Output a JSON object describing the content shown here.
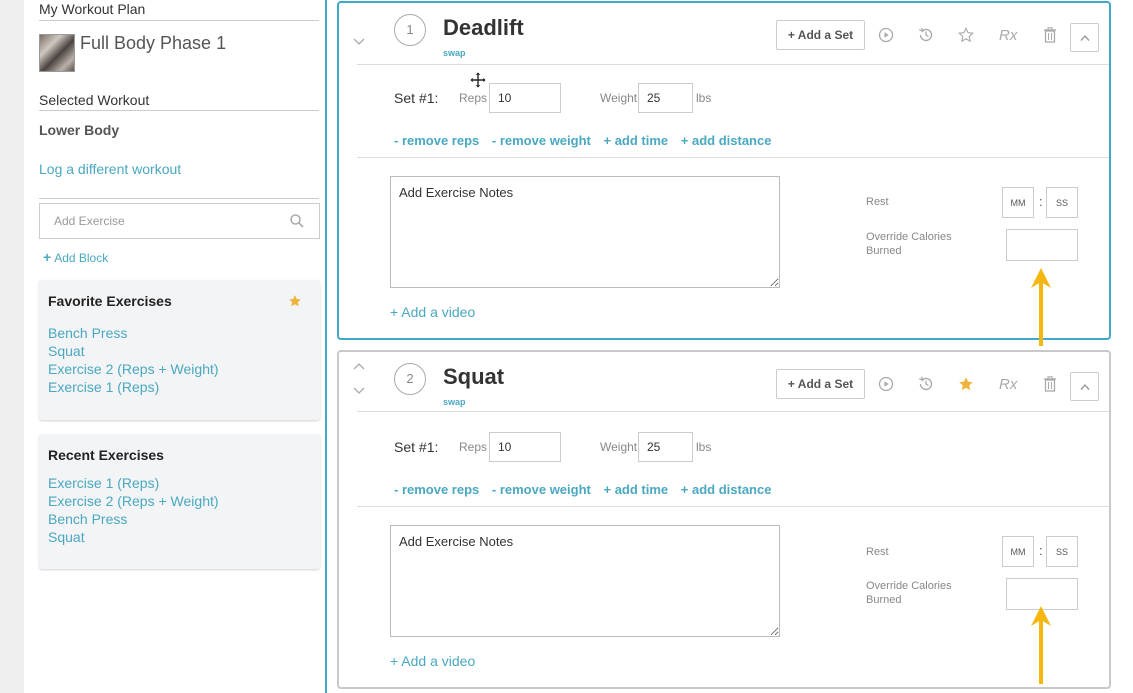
{
  "sidebar": {
    "plan_heading": "My Workout Plan",
    "plan_name": "Full Body Phase 1",
    "selected_heading": "Selected Workout",
    "selected_workout": "Lower Body",
    "log_link": "Log a different workout",
    "add_exercise_placeholder": "Add Exercise",
    "add_block": "Add Block",
    "favorites": {
      "title": "Favorite Exercises",
      "items": [
        "Bench Press",
        "Squat",
        "Exercise 2 (Reps + Weight)",
        "Exercise 1 (Reps)"
      ]
    },
    "recent": {
      "title": "Recent Exercises",
      "items": [
        "Exercise 1 (Reps)",
        "Exercise 2 (Reps + Weight)",
        "Bench Press",
        "Squat"
      ]
    }
  },
  "colors": {
    "accent": "#3fa9c9",
    "link": "#4aa8c0",
    "star": "#f0b43c",
    "arrow": "#f5b70f"
  },
  "exercises": [
    {
      "number": "1",
      "name": "Deadlift",
      "swap": "swap",
      "add_set": "+ Add a Set",
      "rx": "Rx",
      "favorited": false,
      "set_label": "Set #1:",
      "reps_label": "Reps",
      "reps_value": "10",
      "weight_label": "Weight",
      "weight_value": "25",
      "weight_unit": "lbs",
      "actions": [
        "- remove reps",
        "- remove weight",
        "+ add time",
        "+ add distance"
      ],
      "notes_placeholder": "Add Exercise Notes",
      "rest_label": "Rest",
      "rest_mm": "MM",
      "rest_ss": "SS",
      "colon": ":",
      "calories_label": "Override Calories Burned",
      "add_video": "+ Add a video"
    },
    {
      "number": "2",
      "name": "Squat",
      "swap": "swap",
      "add_set": "+ Add a Set",
      "rx": "Rx",
      "favorited": true,
      "set_label": "Set #1:",
      "reps_label": "Reps",
      "reps_value": "10",
      "weight_label": "Weight",
      "weight_value": "25",
      "weight_unit": "lbs",
      "actions": [
        "- remove reps",
        "- remove weight",
        "+ add time",
        "+ add distance"
      ],
      "notes_placeholder": "Add Exercise Notes",
      "rest_label": "Rest",
      "rest_mm": "MM",
      "rest_ss": "SS",
      "colon": ":",
      "calories_label": "Override Calories Burned",
      "add_video": "+ Add a video"
    }
  ]
}
